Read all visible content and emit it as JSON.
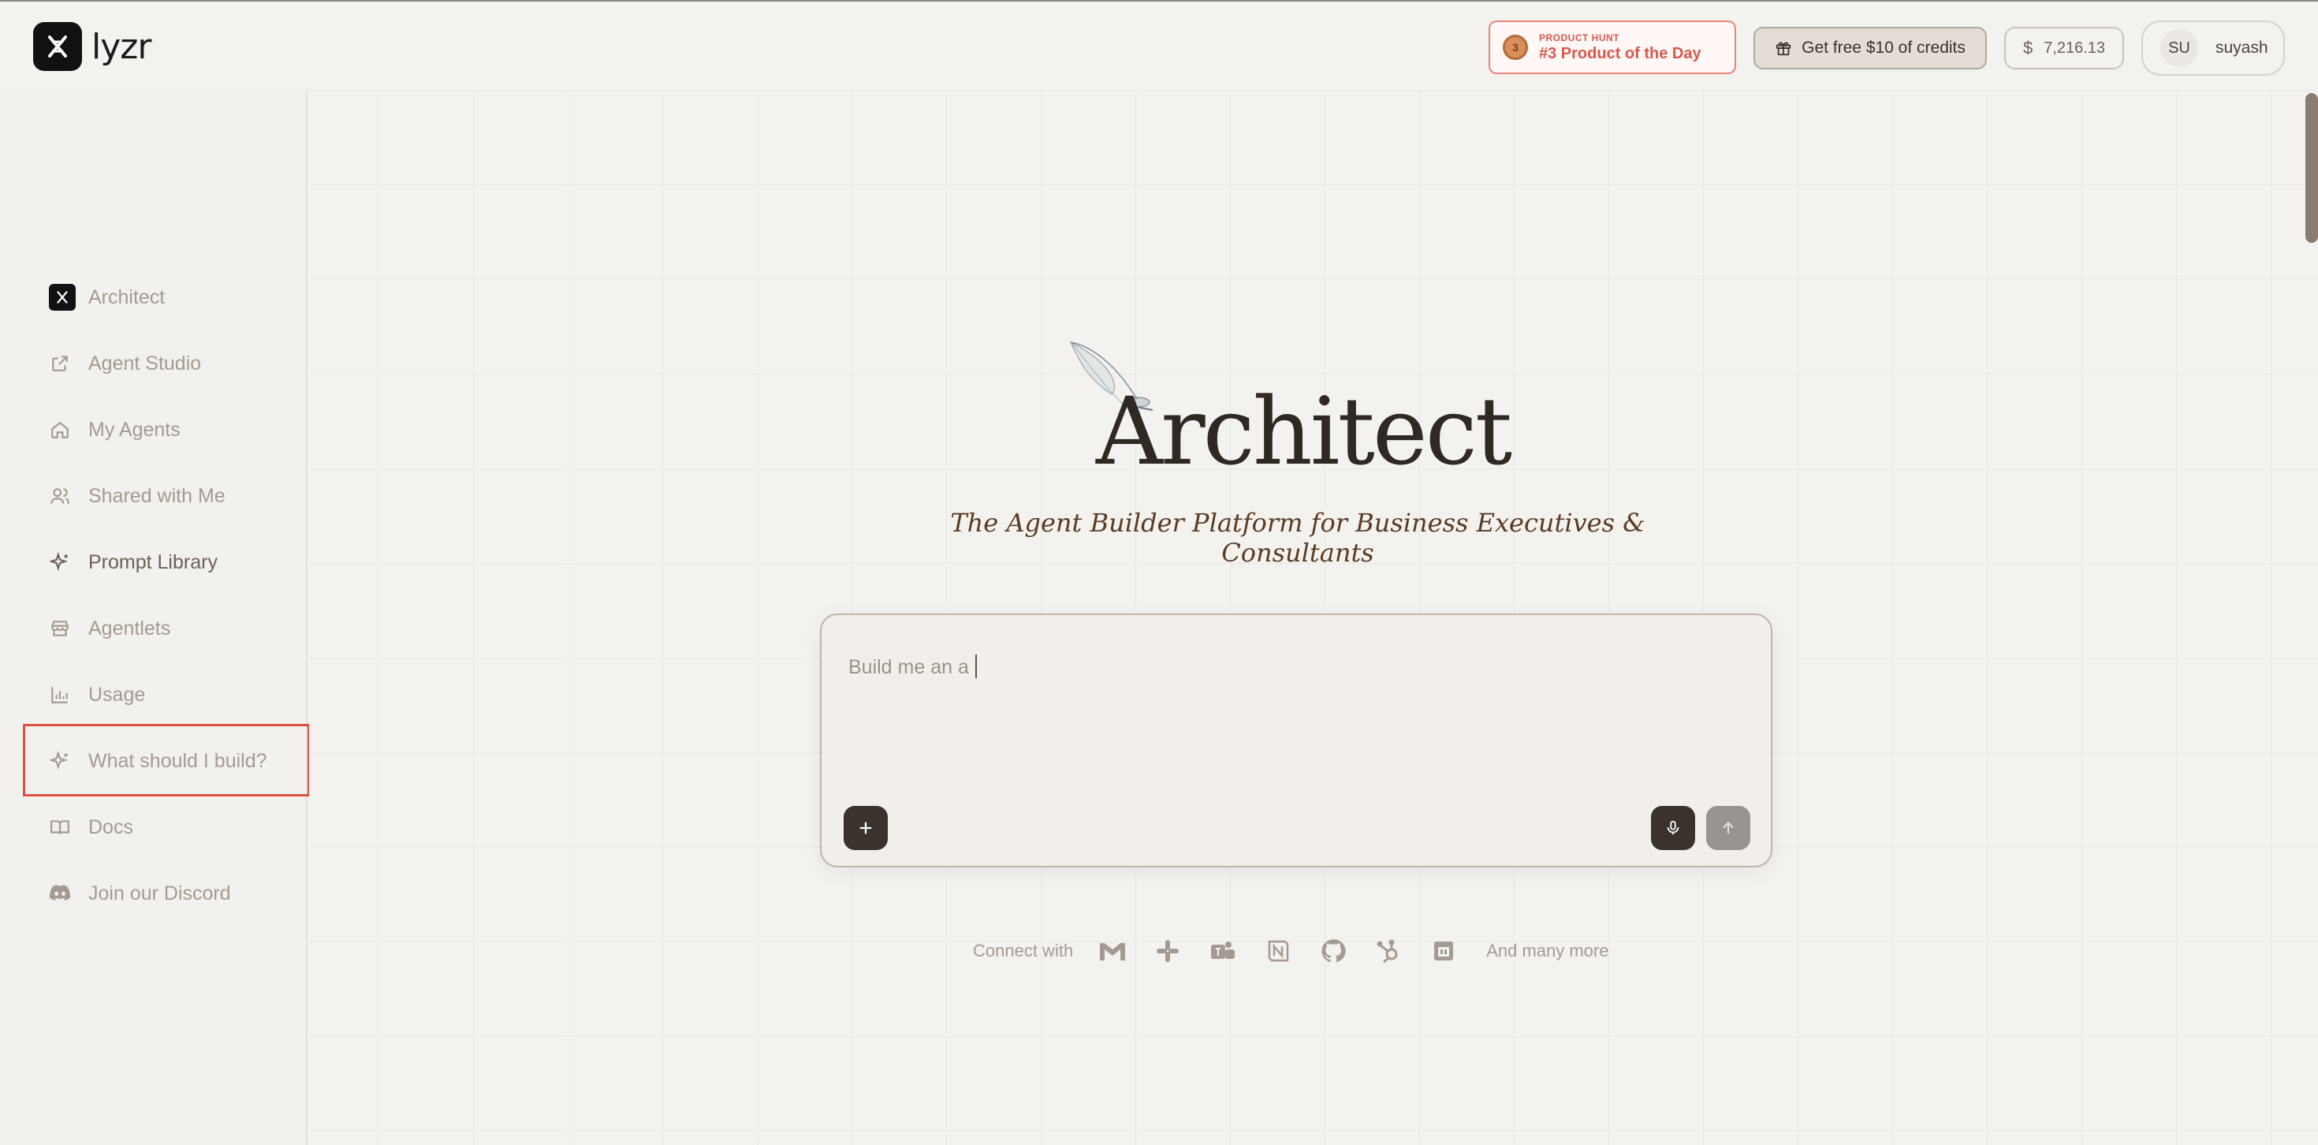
{
  "header": {
    "logo_text": "lyzr",
    "product_hunt": {
      "small": "PRODUCT HUNT",
      "big": "#3 Product of the Day",
      "medal_number": "3"
    },
    "credits_label": "Get free $10 of credits",
    "balance": "7,216.13",
    "balance_symbol": "$",
    "user_initials": "SU",
    "username": "suyash"
  },
  "sidebar": {
    "items": [
      {
        "label": "Architect",
        "icon": "architect-icon"
      },
      {
        "label": "Agent Studio",
        "icon": "external-link-icon"
      },
      {
        "label": "My Agents",
        "icon": "home-icon"
      },
      {
        "label": "Shared with Me",
        "icon": "users-icon"
      },
      {
        "label": "Prompt Library",
        "icon": "sparkle-icon"
      },
      {
        "label": "Agentlets",
        "icon": "store-icon"
      },
      {
        "label": "Usage",
        "icon": "bar-chart-icon"
      },
      {
        "label": "What should I build?",
        "icon": "sparkle-icon"
      },
      {
        "label": "Docs",
        "icon": "book-icon"
      },
      {
        "label": "Join our Discord",
        "icon": "discord-icon"
      }
    ]
  },
  "main": {
    "title": "Architect",
    "subtitle": "The Agent Builder Platform for Business Executives & Consultants",
    "prompt_value": "Build me an a",
    "connect_label": "Connect with",
    "connect_icons": [
      "gmail-icon",
      "slack-icon",
      "teams-icon",
      "notion-icon",
      "github-icon",
      "hubspot-icon",
      "calendar-icon"
    ],
    "more_label": "And many more"
  },
  "colors": {
    "background": "#f4f2ef",
    "accent_dark": "#3a332d",
    "highlight_red": "#e04f3c",
    "product_hunt_red": "#d9584a"
  }
}
